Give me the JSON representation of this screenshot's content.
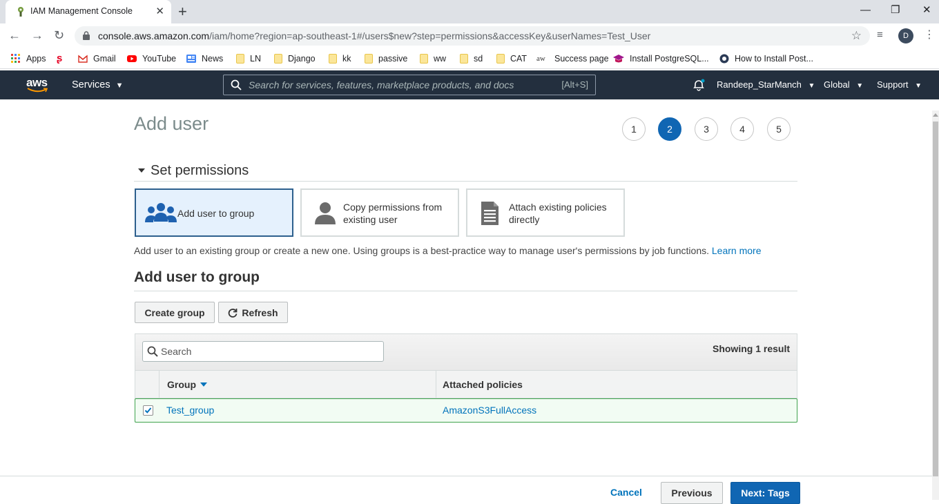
{
  "browser": {
    "tab_title": "IAM Management Console",
    "url_host": "console.aws.amazon.com",
    "url_path": "/iam/home?region=ap-southeast-1#/users$new?step=permissions&accessKey&userNames=Test_User",
    "profile_initial": "D",
    "bookmarks": [
      {
        "label": "Apps",
        "icon": "apps-grid-icon"
      },
      {
        "label": "",
        "icon": "pinterest-icon"
      },
      {
        "label": "Gmail",
        "icon": "gmail-icon"
      },
      {
        "label": "YouTube",
        "icon": "youtube-icon"
      },
      {
        "label": "News",
        "icon": "news-icon"
      },
      {
        "label": "LN",
        "icon": "folder-icon"
      },
      {
        "label": "Django",
        "icon": "folder-icon"
      },
      {
        "label": "kk",
        "icon": "folder-icon"
      },
      {
        "label": "passive",
        "icon": "folder-icon"
      },
      {
        "label": "ww",
        "icon": "folder-icon"
      },
      {
        "label": "sd",
        "icon": "folder-icon"
      },
      {
        "label": "CAT",
        "icon": "folder-icon"
      },
      {
        "label": "Success page",
        "icon": "aw-icon"
      },
      {
        "label": "Install PostgreSQL...",
        "icon": "grad-cap-icon"
      },
      {
        "label": "How to Install Post...",
        "icon": "site-icon"
      }
    ]
  },
  "aws_nav": {
    "logo": "aws",
    "services": "Services",
    "search_placeholder": "Search for services, features, marketplace products, and docs",
    "search_shortcut": "[Alt+S]",
    "user": "Randeep_StarManch",
    "region": "Global",
    "support": "Support"
  },
  "page": {
    "title": "Add user",
    "steps": [
      "1",
      "2",
      "3",
      "4",
      "5"
    ],
    "active_step": 2,
    "section_title": "Set permissions",
    "options": [
      {
        "label": "Add user to group",
        "icon": "users-group-icon",
        "selected": true
      },
      {
        "label": "Copy permissions from existing user",
        "icon": "user-icon",
        "selected": false
      },
      {
        "label": "Attach existing policies directly",
        "icon": "document-icon",
        "selected": false
      }
    ],
    "description": "Add user to an existing group or create a new one. Using groups is a best-practice way to manage user's permissions by job functions.",
    "learn_more": "Learn more",
    "subsection_title": "Add user to group",
    "create_group": "Create group",
    "refresh": "Refresh",
    "table": {
      "search_placeholder": "Search",
      "showing": "Showing 1 result",
      "columns": [
        "Group",
        "Attached policies"
      ],
      "rows": [
        {
          "checked": true,
          "group": "Test_group",
          "policies": "AmazonS3FullAccess"
        }
      ]
    }
  },
  "footer": {
    "cancel": "Cancel",
    "previous": "Previous",
    "next": "Next: Tags"
  },
  "colors": {
    "aws_nav_bg": "#232f3e",
    "primary_blue": "#1066b3",
    "link_blue": "#0073bb",
    "selected_row_border": "#3fa34d"
  }
}
